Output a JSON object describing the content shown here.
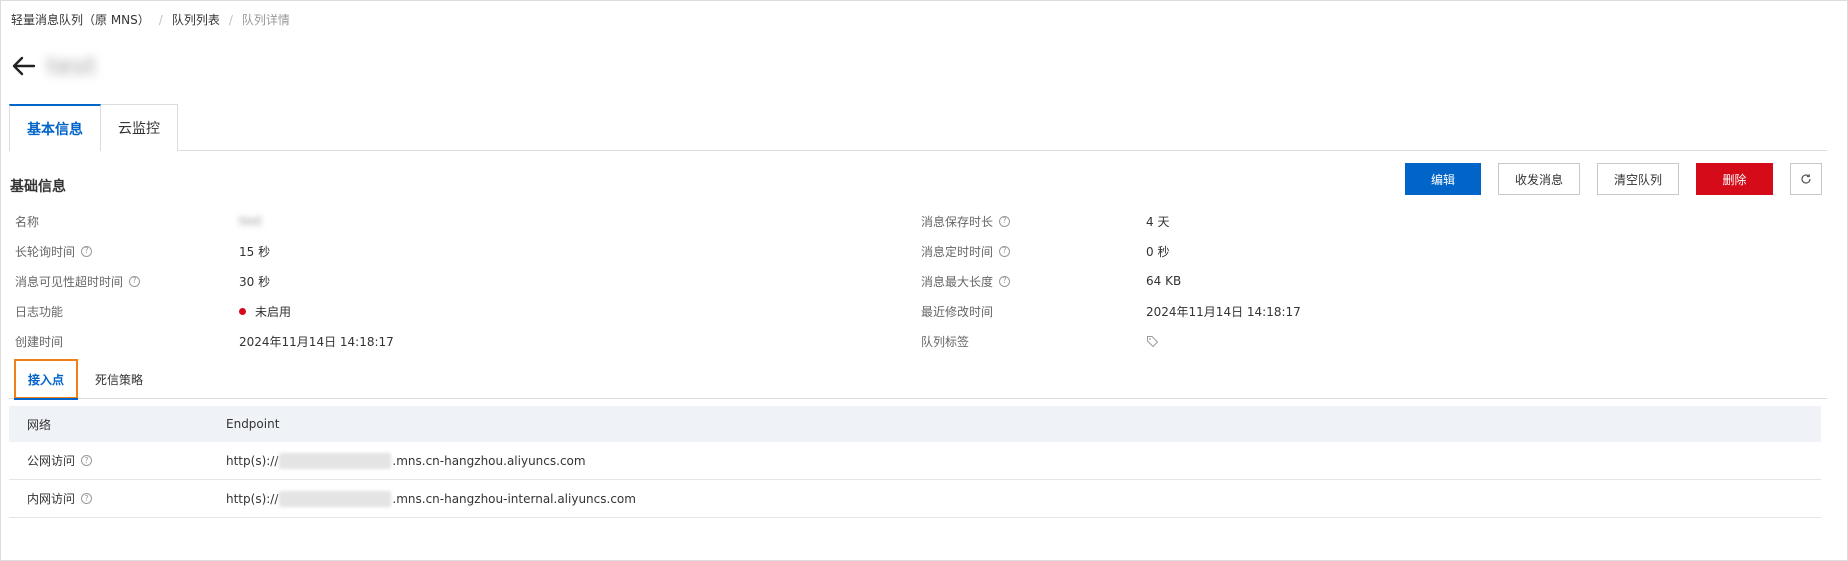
{
  "breadcrumb": {
    "items": [
      "轻量消息队列（原 MNS）",
      "队列列表",
      "队列详情"
    ],
    "separator": "/"
  },
  "page": {
    "title": "test"
  },
  "tabs": {
    "basic": "基本信息",
    "monitor": "云监控"
  },
  "section": {
    "title": "基础信息"
  },
  "toolbar": {
    "edit": "编辑",
    "send_receive": "收发消息",
    "clear_queue": "清空队列",
    "delete": "删除"
  },
  "info": {
    "name_label": "名称",
    "name_value": "test",
    "long_poll_label": "长轮询时间",
    "long_poll_value": "15 秒",
    "visibility_label": "消息可见性超时时间",
    "visibility_value": "30 秒",
    "log_label": "日志功能",
    "log_value": "未启用",
    "created_label": "创建时间",
    "created_value": "2024年11月14日 14:18:17",
    "retention_label": "消息保存时长",
    "retention_value": "4 天",
    "delay_label": "消息定时时间",
    "delay_value": "0 秒",
    "max_size_label": "消息最大长度",
    "max_size_value": "64 KB",
    "modified_label": "最近修改时间",
    "modified_value": "2024年11月14日 14:18:17",
    "tags_label": "队列标签"
  },
  "sub_tabs": {
    "endpoint": "接入点",
    "dead_letter": "死信策略"
  },
  "endpoint_table": {
    "headers": [
      "网络",
      "Endpoint"
    ],
    "rows": [
      {
        "network": "公网访问",
        "prefix": "http(s)://",
        "suffix": ".mns.cn-hangzhou.aliyuncs.com"
      },
      {
        "network": "内网访问",
        "prefix": "http(s)://",
        "suffix": ".mns.cn-hangzhou-internal.aliyuncs.com"
      }
    ]
  },
  "colors": {
    "primary": "#0064c8",
    "danger": "#d50b1a",
    "highlight": "#f07f17",
    "status_disabled": "#d50b1a"
  }
}
